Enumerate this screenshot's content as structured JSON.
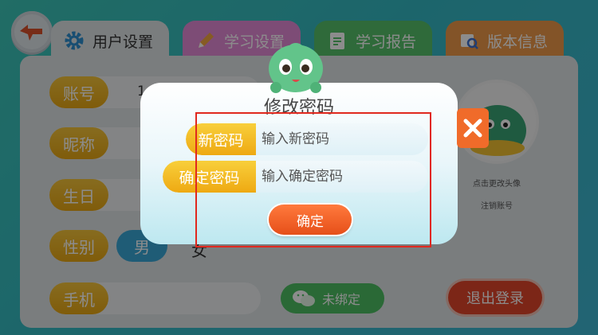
{
  "tabs": [
    {
      "label": "用户设置",
      "icon": "gear-icon"
    },
    {
      "label": "学习设置",
      "icon": "pencil-icon"
    },
    {
      "label": "学习报告",
      "icon": "clipboard-icon"
    },
    {
      "label": "版本信息",
      "icon": "document-search-icon"
    }
  ],
  "profile": {
    "account_label": "账号",
    "account_value": "1",
    "nickname_label": "昵称",
    "birthday_label": "生日",
    "gender_label": "性别",
    "gender_male": "男",
    "gender_female": "女",
    "phone_label": "手机",
    "wechat_label": "未绑定",
    "logout_label": "退出登录",
    "avatar_caption": "点击更改头像",
    "delete_account": "注销账号"
  },
  "dialog": {
    "title": "修改密码",
    "new_password_label": "新密码",
    "new_password_placeholder": "输入新密码",
    "confirm_password_label": "确定密码",
    "confirm_password_placeholder": "输入确定密码",
    "confirm_button": "确定"
  },
  "colors": {
    "accent_orange": "#e64f19",
    "label_yellow": "#eea912",
    "highlight_red": "#e0281e"
  }
}
